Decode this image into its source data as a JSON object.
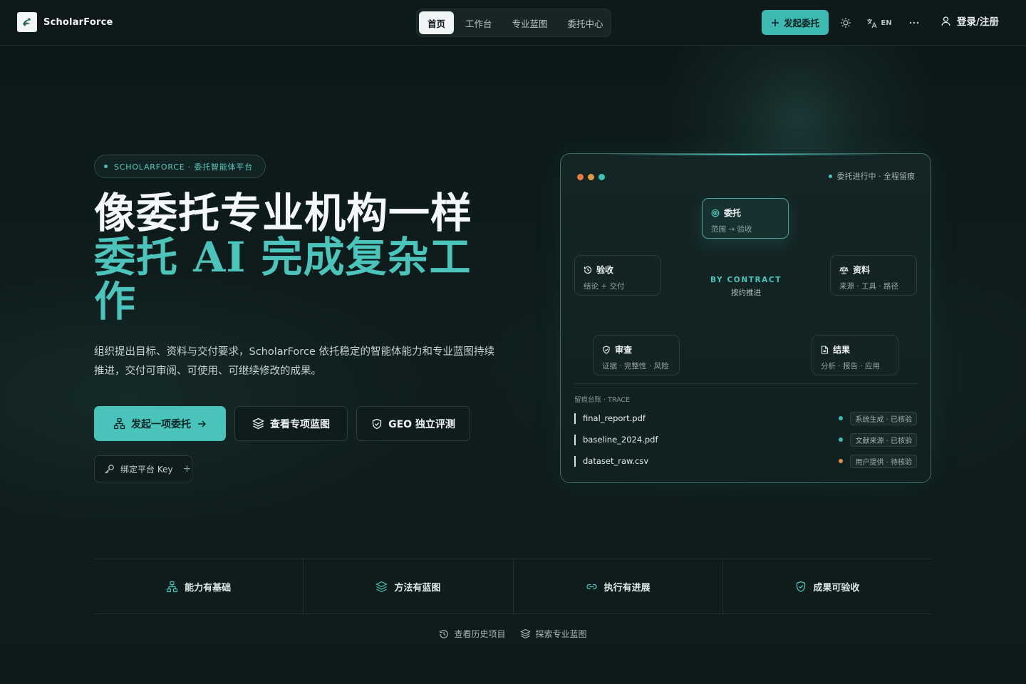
{
  "brand": {
    "name": "ScholarForce"
  },
  "nav": {
    "items": [
      {
        "label": "首页",
        "active": true
      },
      {
        "label": "工作台",
        "active": false
      },
      {
        "label": "专业蓝图",
        "active": false
      },
      {
        "label": "委托中心",
        "active": false
      }
    ]
  },
  "header": {
    "start_label": "发起委托",
    "lang_label": "EN",
    "login_label": "登录/注册"
  },
  "hero": {
    "badge": "SCHOLARFORCE · 委托智能体平台",
    "title_line1": "像委托专业机构一样",
    "title_line2": "委托 AI 完成复杂工作",
    "description": "组织提出目标、资料与交付要求，ScholarForce 依托稳定的智能体能力和专业蓝图持续推进，交付可审阅、可使用、可继续修改的成果。",
    "cta_primary": "发起一项委托",
    "cta_blueprint": "查看专项蓝图",
    "cta_geo": "GEO 独立评测",
    "bind_key": "绑定平台 Key",
    "bind_key_plus": "+"
  },
  "panel": {
    "status": "委托进行中 · 全程留痕",
    "nodes": {
      "entrust": {
        "title": "委托",
        "sub": "范围 → 验收"
      },
      "accept": {
        "title": "验收",
        "sub": "结论 + 交付"
      },
      "material": {
        "title": "资料",
        "sub": "来源 · 工具 · 路径"
      },
      "review": {
        "title": "审查",
        "sub": "证据 · 完整性 · 风险"
      },
      "result": {
        "title": "结果",
        "sub": "分析 · 报告 · 应用"
      }
    },
    "center_title": "BY CONTRACT",
    "center_sub": "按约推进",
    "trace_title": "留痕台账 · TRACE",
    "trace": [
      {
        "file": "final_report.pdf",
        "tag": "系统生成 · 已核验",
        "color": "#3fbab3"
      },
      {
        "file": "baseline_2024.pdf",
        "tag": "文献来源 · 已核验",
        "color": "#3fbab3"
      },
      {
        "file": "dataset_raw.csv",
        "tag": "用户提供 · 待核验",
        "color": "#e0914f"
      }
    ]
  },
  "features": [
    {
      "label": "能力有基础",
      "icon": "network-icon"
    },
    {
      "label": "方法有蓝图",
      "icon": "layers-icon"
    },
    {
      "label": "执行有进展",
      "icon": "link-icon"
    },
    {
      "label": "成果可验收",
      "icon": "shield-check-icon"
    }
  ],
  "footer": {
    "history": "查看历史项目",
    "explore": "探索专业蓝图"
  },
  "colors": {
    "accent": "#4cc4bb",
    "background": "#0d1a1a",
    "warning": "#e0914f",
    "dot_orange": "#e57d45",
    "dot_amber": "#e09a48",
    "dot_teal": "#3fc2b8"
  }
}
